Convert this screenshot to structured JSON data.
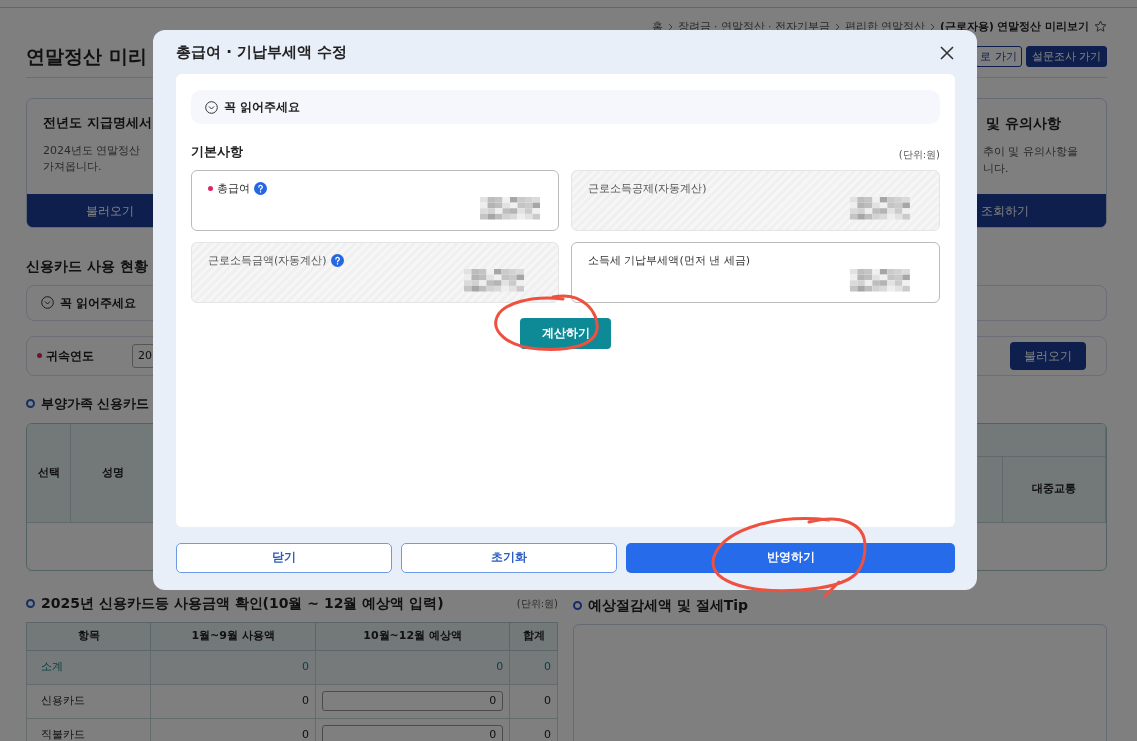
{
  "breadcrumb": [
    {
      "label": "홈",
      "current": false
    },
    {
      "label": "장려금 · 연말정산 · 전자기부금",
      "current": false
    },
    {
      "label": "편리한 연말정산",
      "current": false
    },
    {
      "label": "(근로자용) 연말정산 미리보기",
      "current": true
    }
  ],
  "page": {
    "title": "연말정산 미리",
    "buttons": [
      {
        "label": "로 가기",
        "kind": "outline"
      },
      {
        "label": "설문조사 가기",
        "kind": "solid"
      }
    ]
  },
  "cards": [
    {
      "title": "전년도 지급명세서",
      "lines": [
        "2024년도 연말정산",
        "가져옵니다."
      ],
      "button": "불러오기"
    },
    {
      "title": "및 유의사항",
      "lines": [
        "추이 및 유의사항을",
        "니다."
      ],
      "button": "조회하기"
    }
  ],
  "card_usage": {
    "title": "신용카드 사용 현황",
    "notice": "꼭 읽어주세요",
    "filter": {
      "label": "귀속연도",
      "required": true,
      "value": "20",
      "button": "불러오기"
    }
  },
  "dependents": {
    "title": "부양가족 신용카드",
    "columns": [
      "선택",
      "성명",
      "대중교통"
    ]
  },
  "usage": {
    "title": "2025년 신용카드등 사용금액 확인(10월 ~ 12월 예상액 입력)",
    "unit": "(단위:원)",
    "columns": [
      "항목",
      "1월~9월 사용액",
      "10월~12월 예상액",
      "합계"
    ],
    "rows": [
      {
        "kind": "subtotal",
        "cells": [
          "소계",
          "0",
          "0",
          "0"
        ]
      },
      {
        "kind": "input",
        "cells": [
          "신용카드",
          "0",
          "0",
          "0"
        ]
      },
      {
        "kind": "input",
        "cells": [
          "직불카드",
          "0",
          "0",
          "0"
        ]
      }
    ]
  },
  "tips": {
    "title": "예상절감세액 및 절세Tip"
  },
  "modal": {
    "title": "총급여 · 기납부세액 수정",
    "notice": "꼭 읽어주세요",
    "section": "기본사항",
    "unit": "(단위:원)",
    "fields": [
      {
        "label": "총급여",
        "required": true,
        "help": true,
        "disabled": false
      },
      {
        "label": "근로소득공제(자동계산)",
        "required": false,
        "help": false,
        "disabled": true
      },
      {
        "label": "근로소득금액(자동계산)",
        "required": false,
        "help": true,
        "disabled": true
      },
      {
        "label": "소득세 기납부세액(먼저 낸 세금)",
        "required": false,
        "help": false,
        "disabled": false
      }
    ],
    "calc_button": "계산하기",
    "buttons": [
      {
        "label": "닫기",
        "kind": "outline"
      },
      {
        "label": "초기화",
        "kind": "outline"
      },
      {
        "label": "반영하기",
        "kind": "primary"
      }
    ]
  }
}
